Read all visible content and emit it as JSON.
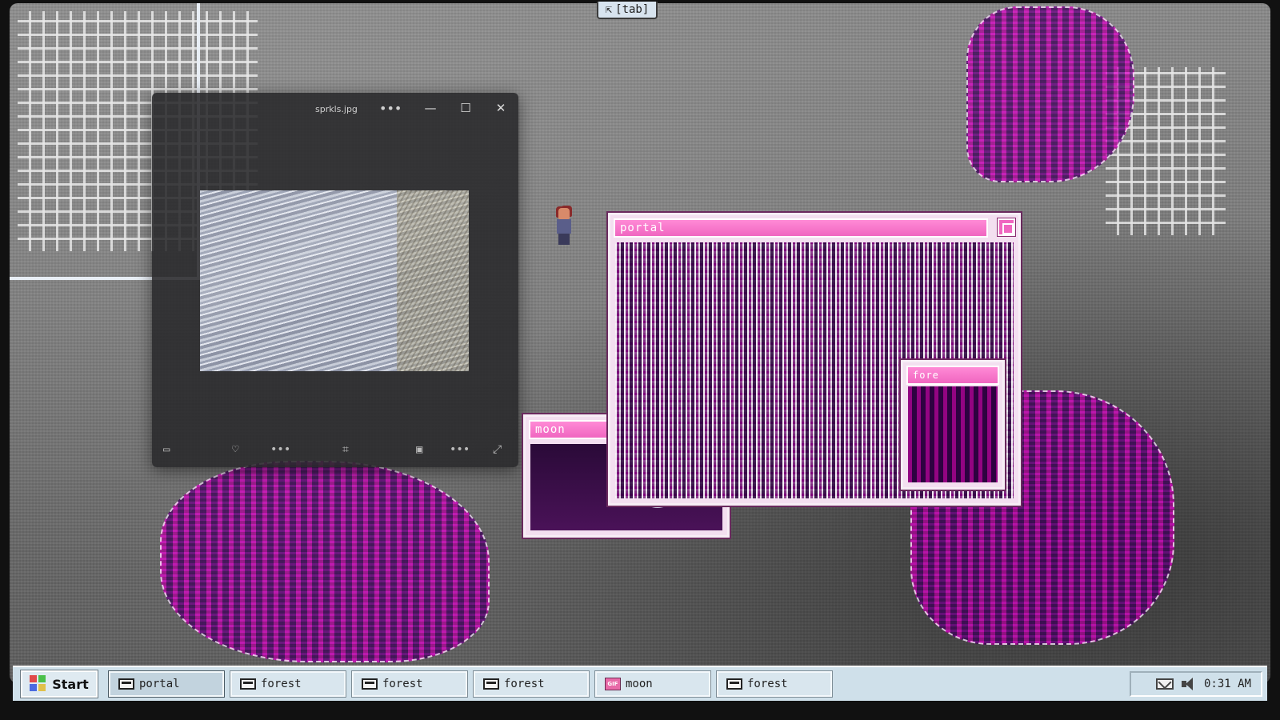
{
  "top_hint": {
    "label": "[tab]"
  },
  "viewer": {
    "filename": "sprkls.jpg",
    "more": "•••",
    "minimize": "—",
    "maximize": "☐",
    "close": "✕"
  },
  "windows": {
    "portal": {
      "title": "portal"
    },
    "moon": {
      "title": "moon"
    },
    "forest": {
      "title": "fore"
    }
  },
  "taskbar": {
    "start_label": "Start",
    "items": [
      {
        "label": "portal",
        "icon": "window-icon",
        "active": true
      },
      {
        "label": "forest",
        "icon": "window-icon"
      },
      {
        "label": "forest",
        "icon": "window-icon"
      },
      {
        "label": "forest",
        "icon": "window-icon"
      },
      {
        "label": "moon",
        "icon": "gif-icon"
      },
      {
        "label": "forest",
        "icon": "window-icon"
      }
    ],
    "gif_badge": "GIF",
    "clock": "0:31 AM"
  },
  "colors": {
    "accent_pink": "#f066c0",
    "taskbar_bg": "#cfe0ea",
    "glitch_purple": "#5a0a6a"
  }
}
